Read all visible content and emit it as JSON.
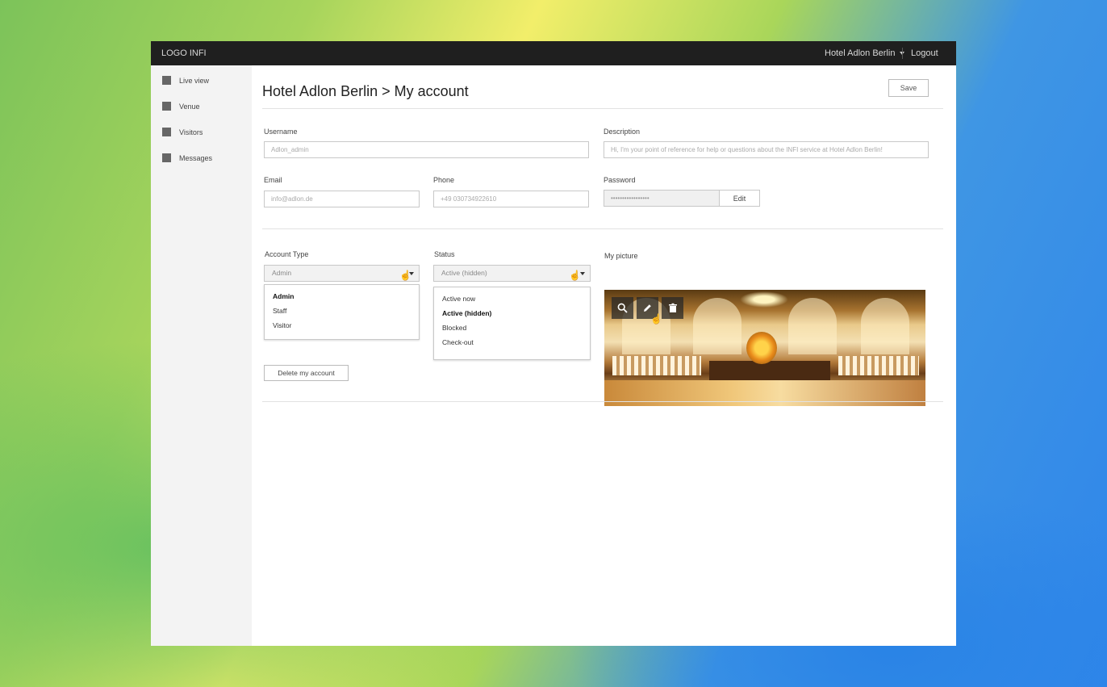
{
  "topbar": {
    "logo": "LOGO INFI",
    "account_name": "Hotel Adlon Berlin",
    "logout": "Logout"
  },
  "sidebar": {
    "items": [
      {
        "label": "Live view"
      },
      {
        "label": "Venue"
      },
      {
        "label": "Visitors"
      },
      {
        "label": "Messages"
      }
    ]
  },
  "page": {
    "title": "Hotel Adlon Berlin > My account",
    "save_label": "Save"
  },
  "form": {
    "username_label": "Username",
    "username_value": "Adlon_admin",
    "description_label": "Description",
    "description_value": "Hi, I'm your point of reference for help or questions about the INFI service at Hotel Adlon Berlin!",
    "email_label": "Email",
    "email_value": "info@adlon.de",
    "phone_label": "Phone",
    "phone_value": "+49 030734922610",
    "password_label": "Password",
    "password_value": "•••••••••••••••••",
    "edit_label": "Edit"
  },
  "account_type": {
    "label": "Account Type",
    "selected": "Admin",
    "options": [
      "Admin",
      "Staff",
      "Visitor"
    ]
  },
  "status": {
    "label": "Status",
    "selected": "Active (hidden)",
    "options": [
      "Active now",
      "Active (hidden)",
      "Blocked",
      "Check-out"
    ]
  },
  "picture": {
    "label": "My picture",
    "tools": [
      "zoom-icon",
      "pencil-icon",
      "trash-icon"
    ]
  },
  "delete_label": "Delete my account"
}
